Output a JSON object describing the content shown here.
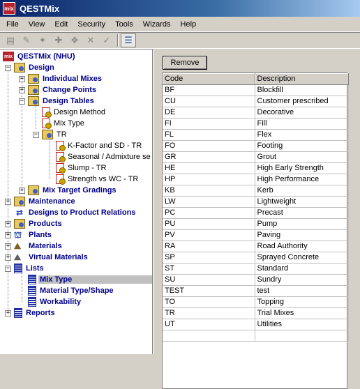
{
  "app": {
    "title": "QESTMix",
    "logo_text": "mix"
  },
  "menu": [
    "File",
    "View",
    "Edit",
    "Security",
    "Tools",
    "Wizards",
    "Help"
  ],
  "toolbar": {
    "buttons": [
      "new-icon",
      "edit-icon",
      "delete-icon",
      "add-icon",
      "copy-icon",
      "cancel-icon",
      "accept-icon",
      "tree-view-icon"
    ]
  },
  "tree": {
    "root": "QESTMix (NHU)",
    "design": "Design",
    "individual_mixes": "Individual Mixes",
    "change_points": "Change Points",
    "design_tables": "Design Tables",
    "design_method": "Design Method",
    "mix_type_dt": "Mix Type",
    "tr": "TR",
    "kfactor": "K-Factor and SD - TR",
    "seasonal": "Seasonal / Admixture se",
    "slump": "Slump - TR",
    "strength": "Strength vs WC - TR",
    "mix_target": "Mix Target Gradings",
    "maintenance": "Maintenance",
    "designs_products": "Designs to Product Relations",
    "products": "Products",
    "plants": "Plants",
    "materials": "Materials",
    "virtual_materials": "Virtual Materials",
    "lists": "Lists",
    "mix_type": "Mix Type",
    "material_type": "Material Type/Shape",
    "workability": "Workability",
    "reports": "Reports"
  },
  "panel": {
    "remove_label": "Remove",
    "col_code": "Code",
    "col_desc": "Description",
    "rows": [
      {
        "code": "BF",
        "desc": "Blockfill"
      },
      {
        "code": "CU",
        "desc": "Customer prescribed"
      },
      {
        "code": "DE",
        "desc": "Decorative"
      },
      {
        "code": "FI",
        "desc": "Fill"
      },
      {
        "code": "FL",
        "desc": "Flex"
      },
      {
        "code": "FO",
        "desc": "Footing"
      },
      {
        "code": "GR",
        "desc": "Grout"
      },
      {
        "code": "HE",
        "desc": "High Early Strength"
      },
      {
        "code": "HP",
        "desc": "High Performance"
      },
      {
        "code": "KB",
        "desc": "Kerb"
      },
      {
        "code": "LW",
        "desc": "Lightweight"
      },
      {
        "code": "PC",
        "desc": "Precast"
      },
      {
        "code": "PU",
        "desc": "Pump"
      },
      {
        "code": "PV",
        "desc": "Paving"
      },
      {
        "code": "RA",
        "desc": "Road Authority"
      },
      {
        "code": "SP",
        "desc": "Sprayed Concrete"
      },
      {
        "code": "ST",
        "desc": "Standard"
      },
      {
        "code": "SU",
        "desc": "Sundry"
      },
      {
        "code": "TEST",
        "desc": "test"
      },
      {
        "code": "TO",
        "desc": "Topping"
      },
      {
        "code": "TR",
        "desc": "Trial Mixes"
      },
      {
        "code": "UT",
        "desc": "Utilities"
      },
      {
        "code": "",
        "desc": ""
      }
    ]
  }
}
